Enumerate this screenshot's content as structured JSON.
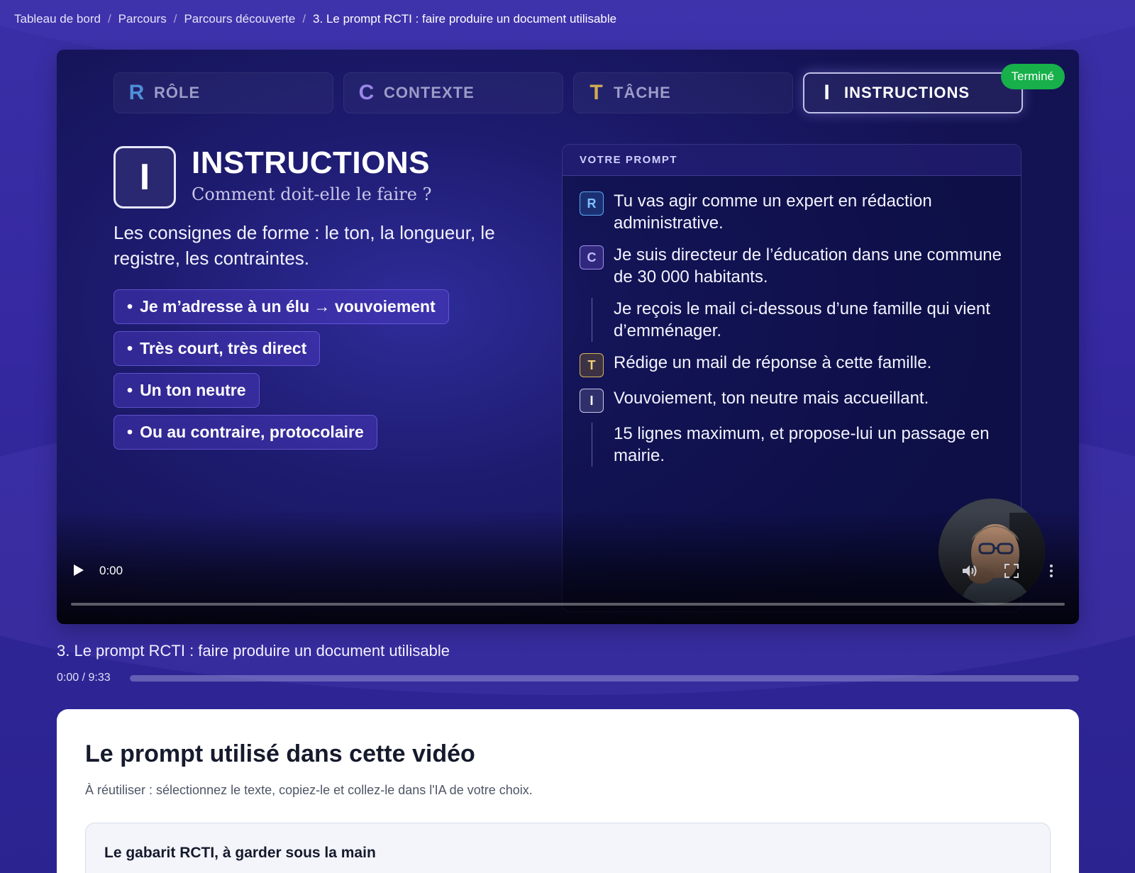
{
  "breadcrumb": [
    {
      "label": "Tableau de bord"
    },
    {
      "label": "Parcours"
    },
    {
      "label": "Parcours découverte"
    },
    {
      "label": "3. Le prompt RCTI : faire produire un document utilisable"
    }
  ],
  "breadcrumb_sep": "/",
  "video": {
    "tabs": [
      {
        "letter": "R",
        "label": "RÔLE",
        "color": "#4f8fd8"
      },
      {
        "letter": "C",
        "label": "CONTEXTE",
        "color": "#9a86e8"
      },
      {
        "letter": "T",
        "label": "TÂCHE",
        "color": "#d0ab55"
      },
      {
        "letter": "I",
        "label": "INSTRUCTIONS",
        "color": "#ffffff"
      }
    ],
    "status_badge": "Terminé",
    "section": {
      "letter": "I",
      "title": "INSTRUCTIONS",
      "subtitle": "Comment doit-elle le faire ?",
      "description": "Les consignes de forme : le ton, la longueur, le registre, les contraintes.",
      "bullets": [
        "Je m’adresse à un élu → vouvoiement",
        "Très court, très direct",
        "Un ton neutre",
        "Ou au contraire, protocolaire"
      ]
    },
    "prompt_panel": {
      "header": "VOTRE PROMPT",
      "lines": [
        {
          "badge": "R",
          "text": "Tu vas agir comme un expert en rédaction administrative."
        },
        {
          "badge": "C",
          "text": "Je suis directeur de l’éducation dans une commune de 30 000 habitants."
        },
        {
          "badge": "",
          "text": "Je reçois le mail ci-dessous d’une famille qui vient d’emménager."
        },
        {
          "badge": "T",
          "text": "Rédige un mail de réponse à cette famille."
        },
        {
          "badge": "I",
          "text": "Vouvoiement, ton neutre mais accueillant."
        },
        {
          "badge": "",
          "text": "15 lignes maximum, et propose-lui un passage en mairie."
        }
      ]
    },
    "player": {
      "current_time": "0:00",
      "play_icon": "play-icon",
      "volume_icon": "volume-icon",
      "fullscreen_icon": "fullscreen-icon",
      "more_icon": "more-vertical-icon"
    }
  },
  "lesson": {
    "title": "3. Le prompt RCTI : faire produire un document utilisable",
    "time": "0:00 / 9:33",
    "progress": 0
  },
  "card": {
    "title": "Le prompt utilisé dans cette vidéo",
    "subtitle": "À réutiliser : sélectionnez le texte, copiez-le et collez-le dans l'IA de votre choix.",
    "gabarit_title": "Le gabarit RCTI, à garder sous la main"
  },
  "colors": {
    "accent": "#3a2fa6",
    "status_done": "#17b04a"
  }
}
